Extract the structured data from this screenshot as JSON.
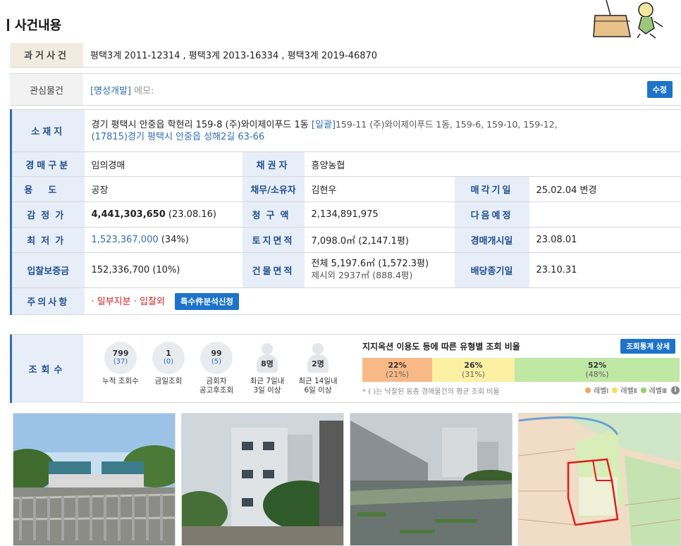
{
  "header": {
    "title": "사건내용"
  },
  "past_cases": {
    "label": "과거사건",
    "value": "평택3계 2011-12314  , 평택3계 2013-16334  , 평택3계 2019-46870"
  },
  "interest": {
    "label": "관심물건",
    "tag": "[명성개발]",
    "memo": "메모:",
    "edit_label": "수정"
  },
  "location": {
    "label": "소재지",
    "line1": "경기 평택시 안중읍 학현리 159-8 (주)와이제이푸드 1동",
    "bundle_tag": "[일괄]",
    "line1_rest": "159-11 (주)와이제이푸드 1동, 159-6, 159-10, 159-12,",
    "line2": "(17815)경기 평택시  안중읍 성해2길  63-66"
  },
  "rows": {
    "auction_type_label": "경매구분",
    "auction_type": "임의경매",
    "creditor_label": "채권자",
    "creditor": "흥양농협",
    "usage_label": "용도",
    "usage": "공장",
    "debtor_label": "채무/소유자",
    "debtor": "김현우",
    "sale_date_label": "매각기일",
    "sale_date": "25.02.04  변경",
    "appraisal_label": "감정가",
    "appraisal_amount": "4,441,303,650",
    "appraisal_date": "(23.08.16)",
    "claim_label": "청구액",
    "claim": "2,134,891,975",
    "next_label": "다음예정",
    "next": "",
    "min_label": "최저가",
    "min_amount": "1,523,367,000",
    "min_pct": "(34%)",
    "land_label": "토지면적",
    "land": "7,098.0㎡ (2,147.1평)",
    "start_label": "경매개시일",
    "start": "23.08.01",
    "deposit_label": "입찰보증금",
    "deposit": "152,336,700 (10%)",
    "building_label": "건물면적",
    "building": "전체 5,197.6㎡ (1,572.3평)",
    "building_excl": "제시외 2937㎡ (888.4평)",
    "dividend_label": "배당종기일",
    "dividend": "23.10.31",
    "notes_label": "주의사항",
    "notes": "· 일부지분 · 입찰외",
    "special_btn": "특수件분석신청"
  },
  "views": {
    "label": "조회수",
    "stats": [
      {
        "n": "799",
        "p": "(37)",
        "cap1": "누적 조회수",
        "cap2": ""
      },
      {
        "n": "1",
        "p": "(0)",
        "cap1": "금일조회",
        "cap2": ""
      },
      {
        "n": "99",
        "p": "(5)",
        "cap1": "금회차",
        "cap2": "공고후조회"
      }
    ],
    "people": [
      {
        "n": "8명",
        "cap1": "최근 7일내",
        "cap2": "3일 이상"
      },
      {
        "n": "2명",
        "cap1": "최근 14일내",
        "cap2": "6일 이상"
      }
    ],
    "ratio_title": "지지옥션 이용도 등에 따른 유형별 조회 비율",
    "ratio_btn": "조회통계 상세",
    "bars": [
      {
        "pct": "22%",
        "sub": "(21%)",
        "color": "#f8b987",
        "share": 0.22
      },
      {
        "pct": "26%",
        "sub": "(31%)",
        "color": "#fbf0a3",
        "share": 0.26
      },
      {
        "pct": "52%",
        "sub": "(48%)",
        "color": "#bfe8a4",
        "share": 0.52
      }
    ],
    "footnote": "* ( )는 낙찰된 동종 경매물건의 평균 조회 비율",
    "legend": [
      "레벨Ⅰ",
      "레벨Ⅱ",
      "레벨Ⅲ"
    ]
  }
}
